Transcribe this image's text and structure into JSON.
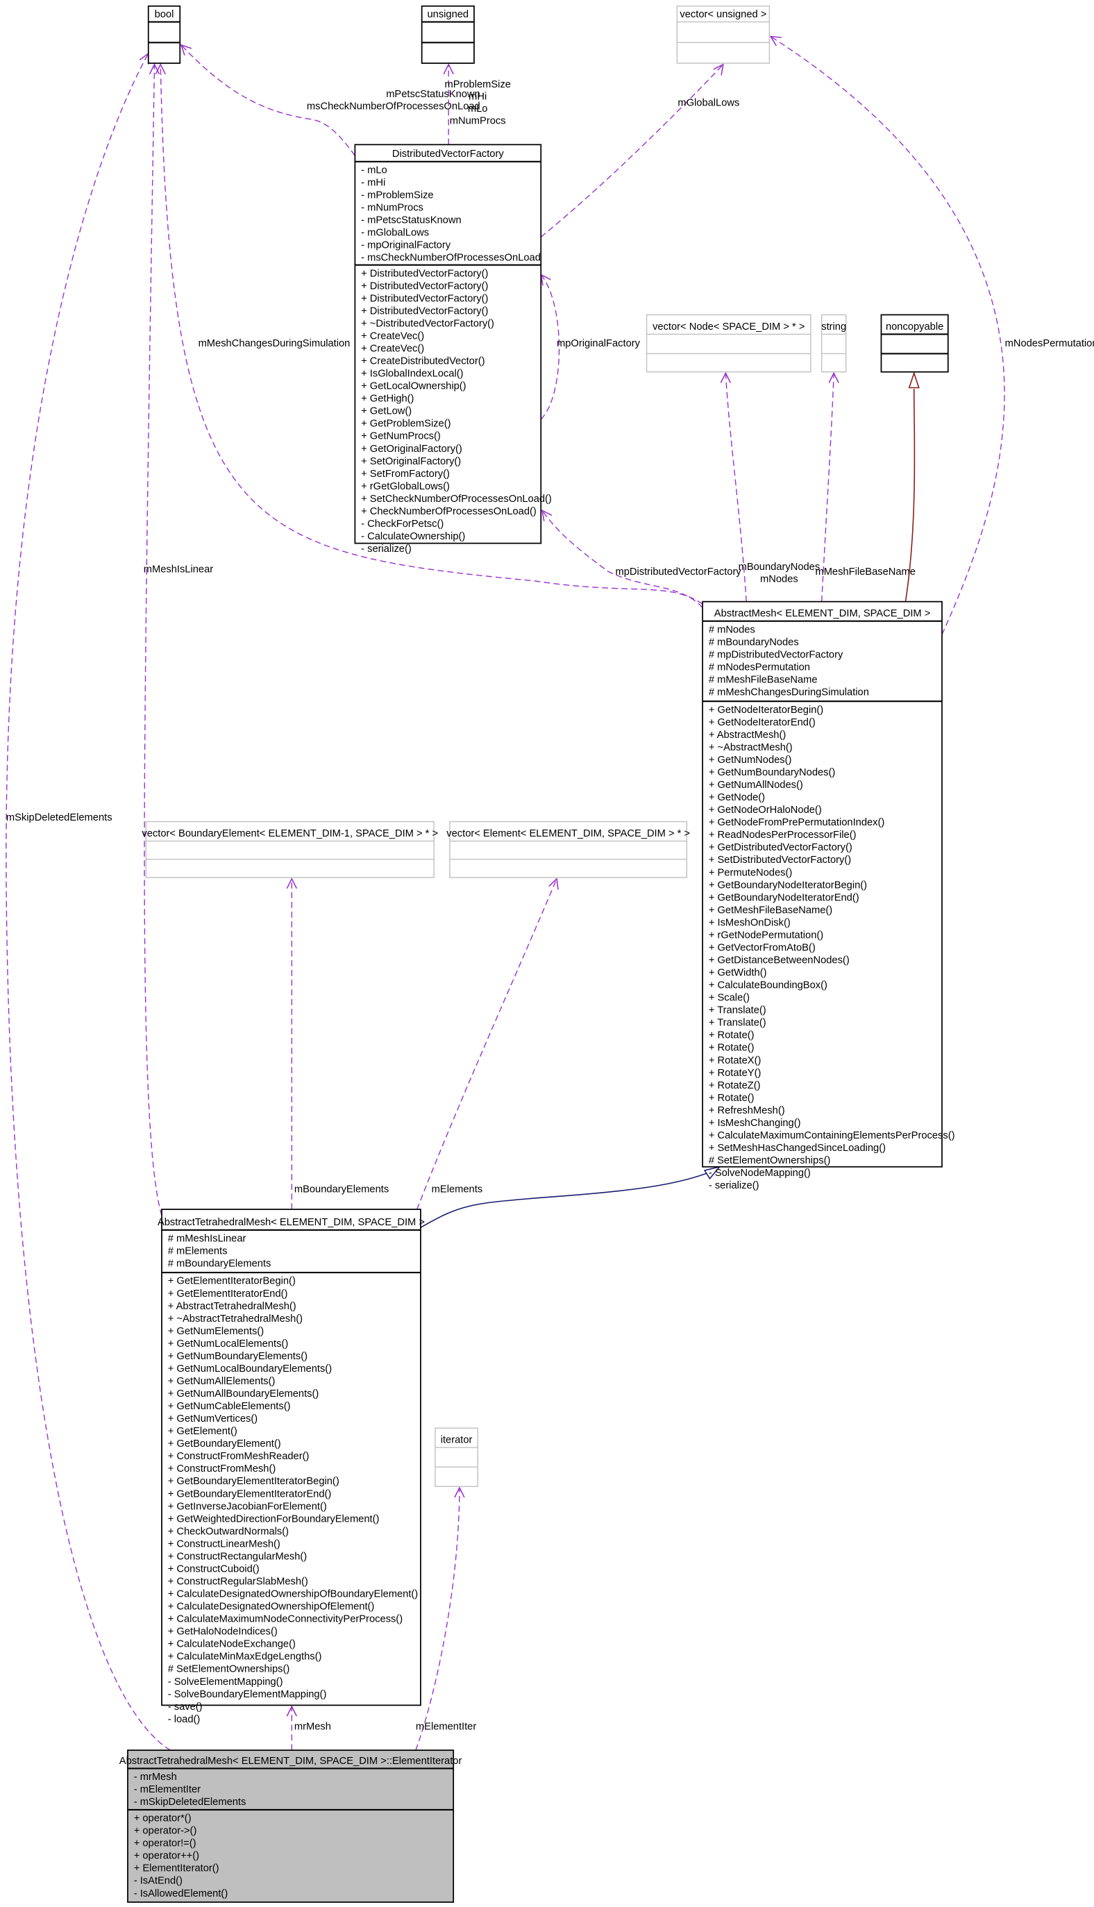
{
  "colors": {
    "dependency": "#9a32cd",
    "inheritance_red": "#8b1a1a",
    "inheritance_blue": "#191970",
    "focus_fill": "#bfbfbf",
    "external_border": "#c0c0c0"
  },
  "classes": {
    "bool": {
      "name": "bool",
      "style": "plain",
      "attrs": [],
      "methods": []
    },
    "unsigned": {
      "name": "unsigned",
      "style": "plain",
      "attrs": [],
      "methods": []
    },
    "vector_unsigned": {
      "name": "vector< unsigned >",
      "style": "external",
      "attrs": [],
      "methods": []
    },
    "dvf": {
      "name": "DistributedVectorFactory",
      "style": "plain",
      "attrs": [
        "- mLo",
        "- mHi",
        "- mProblemSize",
        "- mNumProcs",
        "- mPetscStatusKnown",
        "- mGlobalLows",
        "- mpOriginalFactory",
        "- msCheckNumberOfProcessesOnLoad"
      ],
      "methods": [
        "+ DistributedVectorFactory()",
        "+ DistributedVectorFactory()",
        "+ DistributedVectorFactory()",
        "+ DistributedVectorFactory()",
        "+ ~DistributedVectorFactory()",
        "+ CreateVec()",
        "+ CreateVec()",
        "+ CreateDistributedVector()",
        "+ IsGlobalIndexLocal()",
        "+ GetLocalOwnership()",
        "+ GetHigh()",
        "+ GetLow()",
        "+ GetProblemSize()",
        "+ GetNumProcs()",
        "+ GetOriginalFactory()",
        "+ SetOriginalFactory()",
        "+ SetFromFactory()",
        "+ rGetGlobalLows()",
        "+ SetCheckNumberOfProcessesOnLoad()",
        "+ CheckNumberOfProcessesOnLoad()",
        "- CheckForPetsc()",
        "- CalculateOwnership()",
        "- serialize()"
      ]
    },
    "vector_node": {
      "name": "vector< Node< SPACE_DIM > * >",
      "style": "external",
      "attrs": [],
      "methods": []
    },
    "string": {
      "name": "string",
      "style": "external",
      "attrs": [],
      "methods": []
    },
    "noncopyable": {
      "name": "noncopyable",
      "style": "plain",
      "attrs": [],
      "methods": []
    },
    "abstract_mesh": {
      "name": "AbstractMesh< ELEMENT_DIM, SPACE_DIM >",
      "style": "plain",
      "attrs": [
        "# mNodes",
        "# mBoundaryNodes",
        "# mpDistributedVectorFactory",
        "# mNodesPermutation",
        "# mMeshFileBaseName",
        "# mMeshChangesDuringSimulation"
      ],
      "methods": [
        "+ GetNodeIteratorBegin()",
        "+ GetNodeIteratorEnd()",
        "+ AbstractMesh()",
        "+ ~AbstractMesh()",
        "+ GetNumNodes()",
        "+ GetNumBoundaryNodes()",
        "+ GetNumAllNodes()",
        "+ GetNode()",
        "+ GetNodeOrHaloNode()",
        "+ GetNodeFromPrePermutationIndex()",
        "+ ReadNodesPerProcessorFile()",
        "+ GetDistributedVectorFactory()",
        "+ SetDistributedVectorFactory()",
        "+ PermuteNodes()",
        "+ GetBoundaryNodeIteratorBegin()",
        "+ GetBoundaryNodeIteratorEnd()",
        "+ GetMeshFileBaseName()",
        "+ IsMeshOnDisk()",
        "+ rGetNodePermutation()",
        "+ GetVectorFromAtoB()",
        "+ GetDistanceBetweenNodes()",
        "+ GetWidth()",
        "+ CalculateBoundingBox()",
        "+ Scale()",
        "+ Translate()",
        "+ Translate()",
        "+ Rotate()",
        "+ Rotate()",
        "+ RotateX()",
        "+ RotateY()",
        "+ RotateZ()",
        "+ Rotate()",
        "+ RefreshMesh()",
        "+ IsMeshChanging()",
        "+ CalculateMaximumContainingElementsPerProcess()",
        "+ SetMeshHasChangedSinceLoading()",
        "# SetElementOwnerships()",
        "- SolveNodeMapping()",
        "- serialize()"
      ]
    },
    "vector_boundary_element": {
      "name": "vector< BoundaryElement< ELEMENT_DIM-1, SPACE_DIM > * >",
      "style": "external",
      "attrs": [],
      "methods": []
    },
    "vector_element": {
      "name": "vector< Element< ELEMENT_DIM, SPACE_DIM > * >",
      "style": "external",
      "attrs": [],
      "methods": []
    },
    "atm": {
      "name": "AbstractTetrahedralMesh< ELEMENT_DIM, SPACE_DIM >",
      "style": "plain",
      "attrs": [
        "# mMeshIsLinear",
        "# mElements",
        "# mBoundaryElements"
      ],
      "methods": [
        "+ GetElementIteratorBegin()",
        "+ GetElementIteratorEnd()",
        "+ AbstractTetrahedralMesh()",
        "+ ~AbstractTetrahedralMesh()",
        "+ GetNumElements()",
        "+ GetNumLocalElements()",
        "+ GetNumBoundaryElements()",
        "+ GetNumLocalBoundaryElements()",
        "+ GetNumAllElements()",
        "+ GetNumAllBoundaryElements()",
        "+ GetNumCableElements()",
        "+ GetNumVertices()",
        "+ GetElement()",
        "+ GetBoundaryElement()",
        "+ ConstructFromMeshReader()",
        "+ ConstructFromMesh()",
        "+ GetBoundaryElementIteratorBegin()",
        "+ GetBoundaryElementIteratorEnd()",
        "+ GetInverseJacobianForElement()",
        "+ GetWeightedDirectionForBoundaryElement()",
        "+ CheckOutwardNormals()",
        "+ ConstructLinearMesh()",
        "+ ConstructRectangularMesh()",
        "+ ConstructCuboid()",
        "+ ConstructRegularSlabMesh()",
        "+ CalculateDesignatedOwnershipOfBoundaryElement()",
        "+ CalculateDesignatedOwnershipOfElement()",
        "+ CalculateMaximumNodeConnectivityPerProcess()",
        "+ GetHaloNodeIndices()",
        "+ CalculateNodeExchange()",
        "+ CalculateMinMaxEdgeLengths()",
        "# SetElementOwnerships()",
        "- SolveElementMapping()",
        "- SolveBoundaryElementMapping()",
        "- save()",
        "- load()"
      ]
    },
    "iterator": {
      "name": "iterator",
      "style": "external",
      "attrs": [],
      "methods": []
    },
    "element_iterator": {
      "name": "AbstractTetrahedralMesh< ELEMENT_DIM, SPACE_DIM >::ElementIterator",
      "style": "focus",
      "attrs": [
        "- mrMesh",
        "- mElementIter",
        "- mSkipDeletedElements"
      ],
      "methods": [
        "+ operator*()",
        "+ operator->()",
        "+ operator!=()",
        "+ operator++()",
        "+ ElementIterator()",
        "- IsAtEnd()",
        "- IsAllowedElement()"
      ]
    }
  },
  "edges": [
    {
      "id": "e_skip",
      "from": "element_iterator",
      "to": "bool",
      "kind": "usage",
      "labels": [
        "mSkipDeletedElements"
      ]
    },
    {
      "id": "e_linear",
      "from": "atm",
      "to": "bool",
      "kind": "usage",
      "labels": [
        "mMeshIsLinear"
      ]
    },
    {
      "id": "e_changes",
      "from": "abstract_mesh",
      "to": "bool",
      "kind": "usage",
      "labels": [
        "mMeshChangesDuringSimulation"
      ]
    },
    {
      "id": "e_petsc",
      "from": "dvf",
      "to": "bool",
      "kind": "usage",
      "labels": [
        "mPetscStatusKnown",
        "msCheckNumberOfProcessesOnLoad"
      ]
    },
    {
      "id": "e_unsigned",
      "from": "dvf",
      "to": "unsigned",
      "kind": "usage",
      "labels": [
        "mProblemSize",
        "mHi",
        "mLo",
        "mNumProcs"
      ]
    },
    {
      "id": "e_globallows",
      "from": "dvf",
      "to": "vector_unsigned",
      "kind": "usage",
      "labels": [
        "mGlobalLows"
      ]
    },
    {
      "id": "e_orig",
      "from": "dvf",
      "to": "dvf",
      "kind": "usage",
      "labels": [
        "mpOriginalFactory"
      ]
    },
    {
      "id": "e_pdvf",
      "from": "abstract_mesh",
      "to": "dvf",
      "kind": "usage",
      "labels": [
        "mpDistributedVectorFactory"
      ]
    },
    {
      "id": "e_nodes",
      "from": "abstract_mesh",
      "to": "vector_node",
      "kind": "usage",
      "labels": [
        "mBoundaryNodes",
        "mNodes"
      ]
    },
    {
      "id": "e_fname",
      "from": "abstract_mesh",
      "to": "string",
      "kind": "usage",
      "labels": [
        "mMeshFileBaseName"
      ]
    },
    {
      "id": "e_noncopy",
      "from": "abstract_mesh",
      "to": "noncopyable",
      "kind": "inherit-red",
      "labels": []
    },
    {
      "id": "e_perm",
      "from": "abstract_mesh",
      "to": "vector_unsigned",
      "kind": "usage",
      "labels": [
        "mNodesPermutation"
      ]
    },
    {
      "id": "e_belem",
      "from": "atm",
      "to": "vector_boundary_element",
      "kind": "usage",
      "labels": [
        "mBoundaryElements"
      ]
    },
    {
      "id": "e_elem",
      "from": "atm",
      "to": "vector_element",
      "kind": "usage",
      "labels": [
        "mElements"
      ]
    },
    {
      "id": "e_inherit",
      "from": "atm",
      "to": "abstract_mesh",
      "kind": "inherit-blue",
      "labels": []
    },
    {
      "id": "e_mrmesh",
      "from": "element_iterator",
      "to": "atm",
      "kind": "usage",
      "labels": [
        "mrMesh"
      ]
    },
    {
      "id": "e_iter",
      "from": "element_iterator",
      "to": "iterator",
      "kind": "usage",
      "labels": [
        "mElementIter"
      ]
    }
  ]
}
